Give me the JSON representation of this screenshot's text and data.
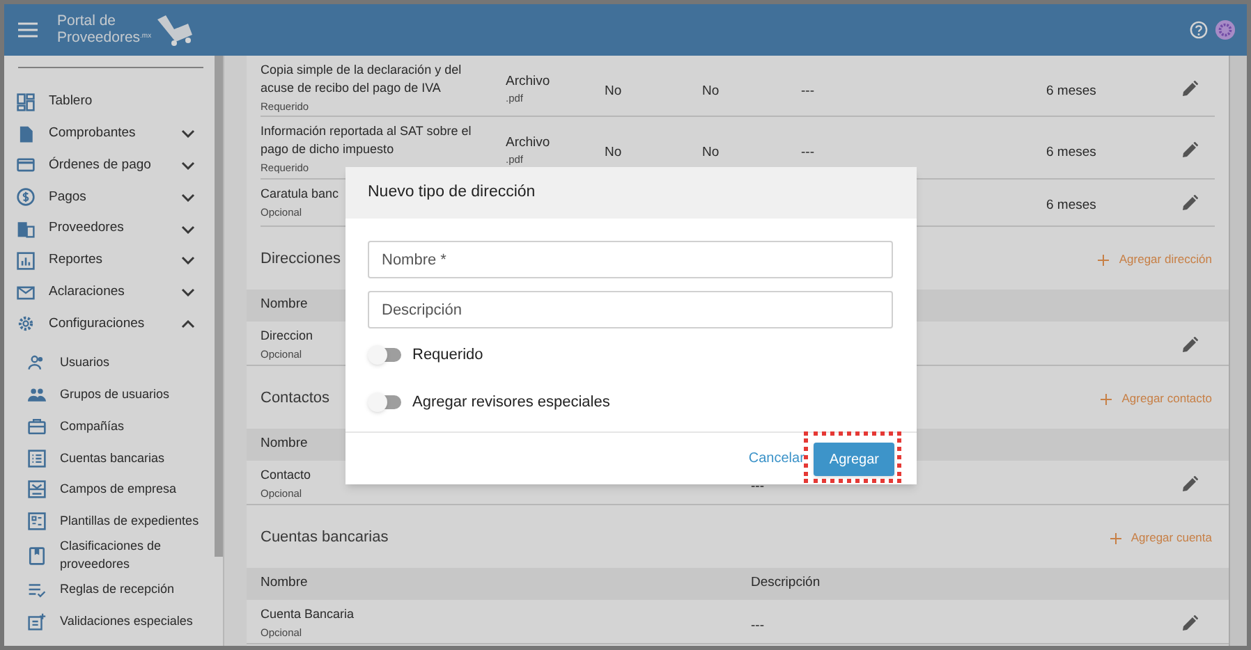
{
  "header": {
    "logo_line1": "Portal de",
    "logo_line2": "Proveedores",
    "logo_suffix": ".mx"
  },
  "sidebar": {
    "items": [
      {
        "label": "Tablero"
      },
      {
        "label": "Comprobantes",
        "expanded": false
      },
      {
        "label": "Órdenes de pago",
        "expanded": false
      },
      {
        "label": "Pagos",
        "expanded": false
      },
      {
        "label": "Proveedores",
        "expanded": false
      },
      {
        "label": "Reportes",
        "expanded": false
      },
      {
        "label": "Aclaraciones",
        "expanded": false
      },
      {
        "label": "Configuraciones",
        "expanded": true,
        "children": [
          {
            "label": "Usuarios"
          },
          {
            "label": "Grupos de usuarios"
          },
          {
            "label": "Compañías"
          },
          {
            "label": "Cuentas bancarias"
          },
          {
            "label": "Campos de empresa"
          },
          {
            "label": "Plantillas de expedientes"
          },
          {
            "label": "Clasificaciones de proveedores"
          },
          {
            "label": "Reglas de recepción"
          },
          {
            "label": "Validaciones especiales"
          }
        ]
      }
    ]
  },
  "documents": {
    "rows": [
      {
        "name": "Copia simple de la declaración y del acuse de recibo del pago de IVA",
        "requirement": "Requerido",
        "type": "Archivo",
        "extension": ".pdf",
        "column_3": "No",
        "column_4": "No",
        "column_5": "---",
        "duration": "6 meses"
      },
      {
        "name": "Información reportada al SAT sobre el pago de dicho impuesto",
        "requirement": "Requerido",
        "type": "Archivo",
        "extension": ".pdf",
        "column_3": "No",
        "column_4": "No",
        "column_5": "---",
        "duration": "6 meses"
      },
      {
        "name": "Caratula banc",
        "requirement": "Opcional",
        "duration": "6 meses"
      }
    ]
  },
  "sections": [
    {
      "title": "Direcciones",
      "action": "Agregar dirección",
      "columns": [
        "Nombre"
      ],
      "rows": [
        {
          "name": "Direccion",
          "requirement": "Opcional"
        }
      ]
    },
    {
      "title": "Contactos",
      "action": "Agregar contacto",
      "columns": [
        "Nombre"
      ],
      "rows": [
        {
          "name": "Contacto",
          "requirement": "Opcional",
          "description": "---"
        }
      ]
    },
    {
      "title": "Cuentas bancarias",
      "action": "Agregar cuenta",
      "columns": [
        "Nombre",
        "Descripción"
      ],
      "rows": [
        {
          "name": "Cuenta Bancaria",
          "requirement": "Opcional",
          "description": "---"
        }
      ]
    }
  ],
  "dialog": {
    "title": "Nuevo tipo de dirección",
    "fields": [
      {
        "placeholder": "Nombre *"
      },
      {
        "placeholder": "Descripción"
      }
    ],
    "toggles": [
      {
        "label": "Requerido",
        "on": false
      },
      {
        "label": "Agregar revisores especiales",
        "on": false
      }
    ],
    "cancel": "Cancelar",
    "submit": "Agregar",
    "submit_highlighted": true
  }
}
